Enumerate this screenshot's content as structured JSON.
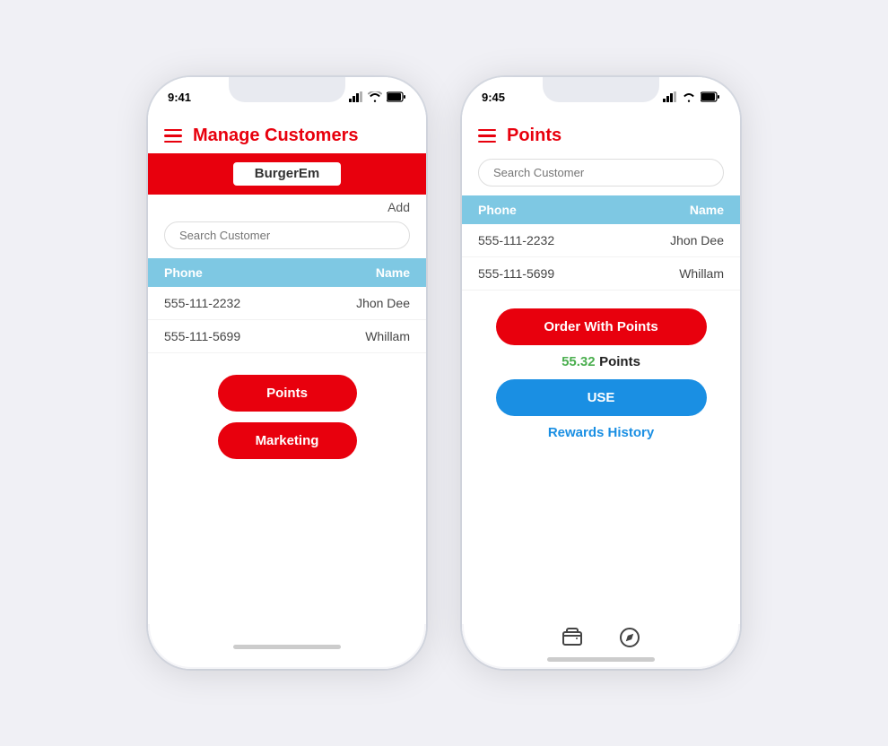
{
  "phone1": {
    "time": "9:41",
    "title": "Manage Customers",
    "brand": "BurgerEm",
    "add_label": "Add",
    "search_placeholder": "Search Customer",
    "table": {
      "col_phone": "Phone",
      "col_name": "Name",
      "rows": [
        {
          "phone": "555-111-2232",
          "name": "Jhon Dee"
        },
        {
          "phone": "555-111-5699",
          "name": "Whillam"
        }
      ]
    },
    "buttons": [
      {
        "label": "Points",
        "id": "points-btn"
      },
      {
        "label": "Marketing",
        "id": "marketing-btn"
      }
    ]
  },
  "phone2": {
    "time": "9:45",
    "title": "Points",
    "search_placeholder": "Search Customer",
    "table": {
      "col_phone": "Phone",
      "col_name": "Name",
      "rows": [
        {
          "phone": "555-111-2232",
          "name": "Jhon Dee"
        },
        {
          "phone": "555-111-5699",
          "name": "Whillam"
        }
      ]
    },
    "order_with_points_label": "Order With Points",
    "points_value": "55.32",
    "points_suffix": "Points",
    "use_label": "USE",
    "rewards_history_label": "Rewards History"
  },
  "icons": {
    "hamburger": "☰",
    "wallet": "💳",
    "compass": "🧭"
  }
}
